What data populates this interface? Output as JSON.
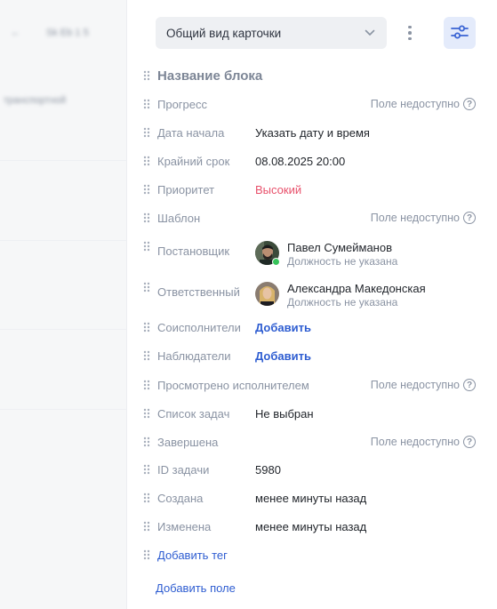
{
  "left": {
    "crumb": "Sk Eb 1 5",
    "title": "транспортной"
  },
  "header": {
    "view_select": "Общий вид карточки"
  },
  "block_title": "Название блока",
  "unavailable_text": "Поле недоступно",
  "help_glyph": "?",
  "fields": {
    "progress": {
      "label": "Прогресс"
    },
    "start_date": {
      "label": "Дата начала",
      "value": "Указать дату и время"
    },
    "deadline": {
      "label": "Крайний срок",
      "value": "08.08.2025 20:00"
    },
    "priority": {
      "label": "Приоритет",
      "value": "Высокий",
      "color": "#e8506b"
    },
    "template": {
      "label": "Шаблон"
    },
    "creator": {
      "label": "Постановщик",
      "name": "Павел Сумейманов",
      "position": "Должность не указана"
    },
    "assignee": {
      "label": "Ответственный",
      "name": "Александра Македонская",
      "position": "Должность не указана"
    },
    "coexecutors": {
      "label": "Соисполнители",
      "value": "Добавить"
    },
    "observers": {
      "label": "Наблюдатели",
      "value": "Добавить"
    },
    "viewed": {
      "label": "Просмотрено исполнителем"
    },
    "checklist": {
      "label": "Список задач",
      "value": "Не выбран"
    },
    "completed": {
      "label": "Завершена"
    },
    "task_id": {
      "label": "ID задачи",
      "value": "5980"
    },
    "created": {
      "label": "Создана",
      "value": "менее минуты назад"
    },
    "modified": {
      "label": "Изменена",
      "value": "менее минуты назад"
    }
  },
  "add_tag": "Добавить тег",
  "add_field": "Добавить поле",
  "colors": {
    "accent": "#2e5dd1",
    "label": "#8a93a3",
    "danger": "#e8506b",
    "online": "#37c35a"
  }
}
